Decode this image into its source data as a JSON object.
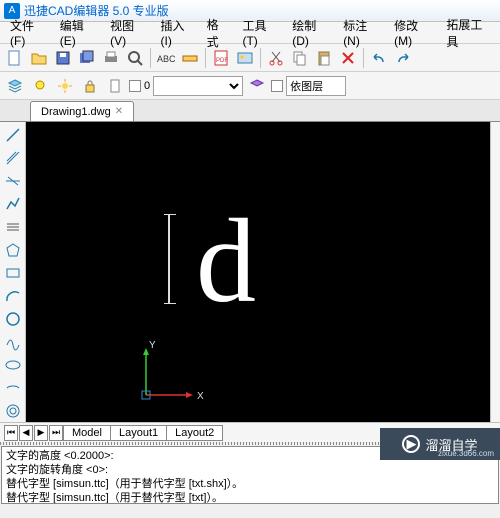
{
  "title": "迅捷CAD编辑器 5.0 专业版",
  "menus": [
    "文件(F)",
    "编辑(E)",
    "视图(V)",
    "插入(I)",
    "格式",
    "工具(T)",
    "绘制(D)",
    "标注(N)",
    "修改(M)",
    "拓展工具"
  ],
  "tab_name": "Drawing1.dwg",
  "layer_label": "依图层",
  "bottom_tabs": {
    "model": "Model",
    "l1": "Layout1",
    "l2": "Layout2"
  },
  "letter": "d",
  "ucs": {
    "x": "X",
    "y": "Y"
  },
  "cmd": {
    "l1": "文字的高度 <0.2000>:",
    "l2": "文字的旋转角度 <0>:",
    "l3": "替代字型 [simsun.ttc]（用于替代字型 [txt.shx]）。",
    "l4": "替代字型 [simsun.ttc]（用于替代字型 [txt]）。"
  },
  "watermark": {
    "brand": "溜溜自学",
    "url": "zixue.3d66.com"
  }
}
